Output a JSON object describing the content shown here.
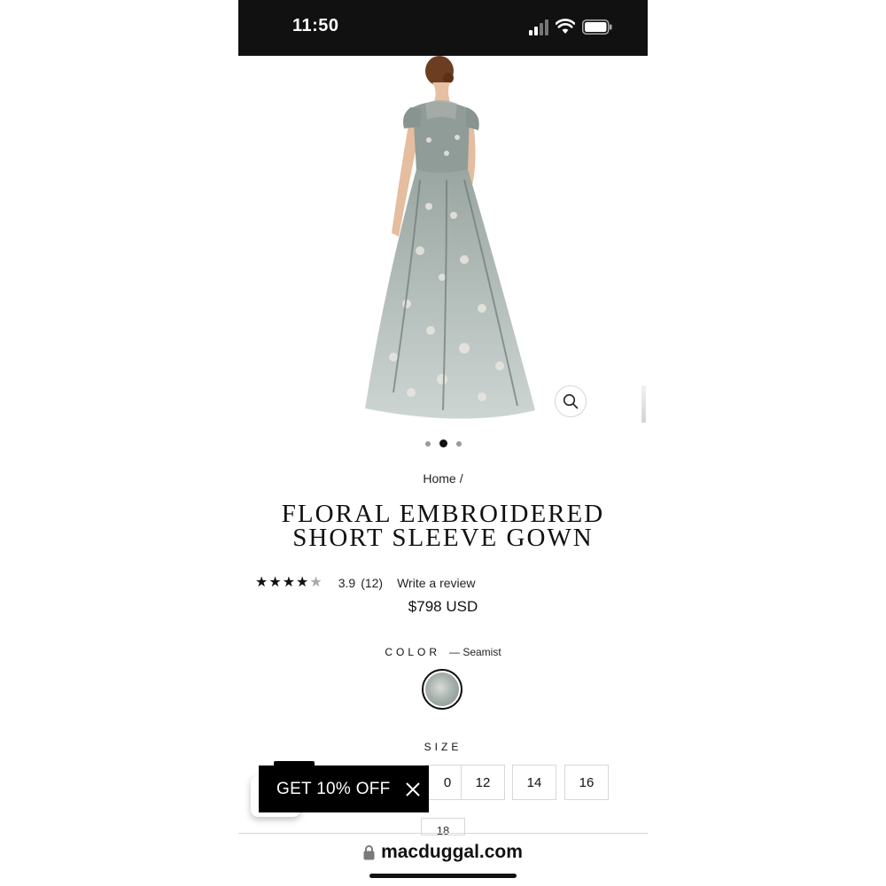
{
  "status_bar": {
    "time": "11:50"
  },
  "product": {
    "breadcrumb": {
      "home": "Home",
      "separator": "/"
    },
    "title": "FLORAL EMBROIDERED SHORT SLEEVE GOWN",
    "rating": {
      "value": "3.9",
      "count": "(12)",
      "stars": 3.9,
      "write_review": "Write a review"
    },
    "price": "$798 USD",
    "gallery": {
      "slides": 3,
      "active_slide": 2
    },
    "color": {
      "label": "COLOR",
      "value": "— Seamist",
      "swatch_color": "#a9b3ae"
    },
    "size": {
      "label": "SIZE",
      "options": [
        "0",
        "12",
        "14",
        "16"
      ],
      "next_row_partial": "18"
    }
  },
  "promo": {
    "label": "GET 10% OFF"
  },
  "browser": {
    "url": "macduggal.com"
  },
  "colors": {
    "status_bar_bg": "#111111",
    "promo_bg": "#000000",
    "text": "#111111"
  }
}
